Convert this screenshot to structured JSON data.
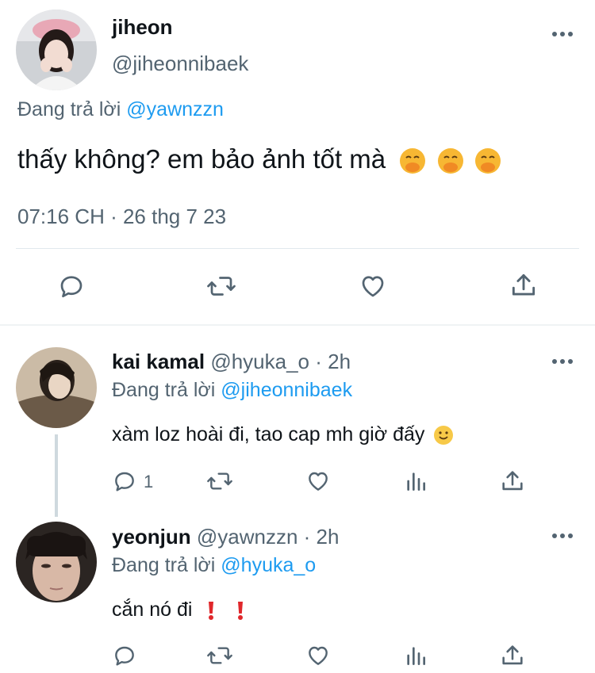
{
  "main_tweet": {
    "display_name": "jiheon",
    "handle": "@jiheonnibaek",
    "replying_prefix": "Đang trả lời",
    "replying_to": "@yawnzzn",
    "text": "thấy không? em bảo ảnh tốt mà",
    "emojis": [
      "face-with-hand-over-mouth",
      "face-with-hand-over-mouth",
      "face-with-hand-over-mouth"
    ],
    "timestamp": "07:16 CH · 26 thg 7 23",
    "actions": [
      "reply-icon",
      "retweet-icon",
      "like-icon",
      "share-icon"
    ]
  },
  "replies": [
    {
      "display_name": "kai kamal",
      "handle_time": "@hyuka_o · 2h",
      "replying_prefix": "Đang trả lời",
      "replying_to": "@jiheonnibaek",
      "text": "xàm loz hoài đi, tao cap mh giờ đấy",
      "emoji": "slightly-smiling-face",
      "reply_count": "1"
    },
    {
      "display_name": "yeonjun",
      "handle_time": "@yawnzzn · 2h",
      "replying_prefix": "Đang trả lời",
      "replying_to": "@hyuka_o",
      "text": "cắn nó đi",
      "emoji": "exclamation-mark"
    }
  ],
  "colors": {
    "text": "#0f1419",
    "secondary": "#536471",
    "link": "#1d9bf0",
    "divider": "#eff3f4"
  }
}
